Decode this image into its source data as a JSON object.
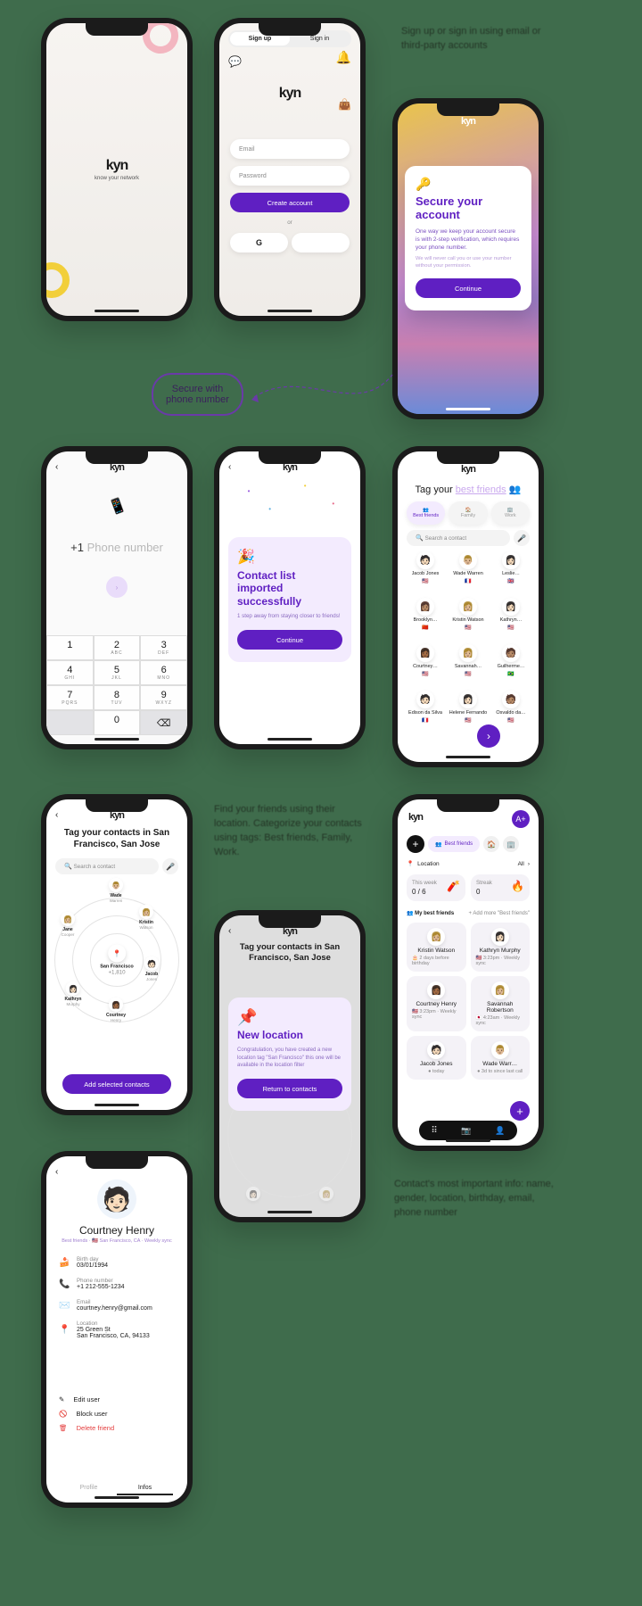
{
  "splash": {
    "brand": "kyn",
    "tagline": "know your network"
  },
  "signup": {
    "tabs": {
      "signup": "Sign up",
      "signin": "Sign in"
    },
    "email_ph": "Email",
    "password_ph": "Password",
    "create_btn": "Create account",
    "or": "or"
  },
  "caption1": "Sign up or sign in using email or third-party accounts",
  "secure": {
    "title": "Secure your account",
    "body": "One way we keep your account secure is with 2-step verification, which requires your phone number.",
    "note": "We will never call you or use your number without your permission.",
    "continue": "Continue"
  },
  "bubble": {
    "line1": "Secure with",
    "line2": "phone number"
  },
  "phone_entry": {
    "prefix": "+1",
    "placeholder": "Phone number",
    "keys": [
      "1",
      "2",
      "3",
      "4",
      "5",
      "6",
      "7",
      "8",
      "9",
      "0"
    ],
    "subs": [
      "",
      "ABC",
      "DEF",
      "GHI",
      "JKL",
      "MNO",
      "PQRS",
      "TUV",
      "WXYZ",
      ""
    ]
  },
  "imported": {
    "title": "Contact list imported successfully",
    "body": "1 step away from staying closer to friends!",
    "continue": "Continue"
  },
  "tag": {
    "title_prefix": "Tag your ",
    "title_highlight": "best friends",
    "search_ph": "Search a contact",
    "tabs": {
      "bf": "Best friends",
      "fam": "Family",
      "work": "Work"
    },
    "contacts": [
      {
        "name": "Jacob Jones",
        "flag": "🇺🇸",
        "emoji": "🧑🏻"
      },
      {
        "name": "Wade Warren",
        "flag": "🇫🇷",
        "emoji": "👨🏼"
      },
      {
        "name": "Leslie…",
        "flag": "🇬🇧",
        "emoji": "👩🏻"
      },
      {
        "name": "Brooklyn…",
        "flag": "🇨🇳",
        "emoji": "👩🏽"
      },
      {
        "name": "Kristin Watson",
        "flag": "🇺🇸",
        "emoji": "👩🏼"
      },
      {
        "name": "Kathryn…",
        "flag": "🇺🇸",
        "emoji": "👩🏻"
      },
      {
        "name": "Courtney…",
        "flag": "🇺🇸",
        "emoji": "👩🏾"
      },
      {
        "name": "Savannah…",
        "flag": "🇺🇸",
        "emoji": "👩🏼"
      },
      {
        "name": "Guilherme…",
        "flag": "🇧🇷",
        "emoji": "🧑🏽"
      },
      {
        "name": "Edison da Silva",
        "flag": "🇫🇷",
        "emoji": "🧑🏻"
      },
      {
        "name": "Helene Fernando",
        "flag": "🇺🇸",
        "emoji": "👩🏻"
      },
      {
        "name": "Osvaldo da…",
        "flag": "🇺🇸",
        "emoji": "🧑🏽"
      }
    ]
  },
  "tag_location": {
    "title": "Tag your contacts in San Francisco, San Jose",
    "search_ph": "Search a contact",
    "center": {
      "label": "San Francisco",
      "count": "+1,810"
    },
    "orbit": [
      {
        "name": "Wade",
        "last": "Warren",
        "emoji": "👨🏼"
      },
      {
        "name": "Kristin",
        "last": "Watson",
        "emoji": "👩🏼"
      },
      {
        "name": "Jacob",
        "last": "Jones",
        "emoji": "🧑🏻"
      },
      {
        "name": "Courtney",
        "last": "Henry",
        "emoji": "👩🏾"
      },
      {
        "name": "Kathryn",
        "last": "Murphy",
        "emoji": "👩🏻"
      },
      {
        "name": "Jane",
        "last": "Cooper",
        "emoji": "👩🏼"
      }
    ],
    "add_btn": "Add selected contacts"
  },
  "caption2": "Find your friends using their location. Categorize your contacts using tags: Best friends, Family, Work.",
  "new_location": {
    "header": "Tag your contacts in San Francisco, San Jose",
    "title": "New location",
    "body": "Congratulation, you have created a new location tag \"San Francisco\" this one will be available in the location filter",
    "btn": "Return to contacts"
  },
  "dashboard": {
    "filter_bf": "Best friends",
    "location_label": "Location",
    "all": "All",
    "week_label": "This week",
    "week_val": "0 / 6",
    "streak_label": "Streak",
    "streak_val": "0",
    "section": "My best friends",
    "add_more": "+ Add more \"Best friends\"",
    "people": [
      {
        "name": "Kristin Watson",
        "meta": "2 days before birthday",
        "emoji": "👩🏼",
        "ico": "🎂"
      },
      {
        "name": "Kathryn Murphy",
        "meta": "3:23pm · Weekly sync",
        "emoji": "👩🏻",
        "flag": "🇺🇸"
      },
      {
        "name": "Courtney Henry",
        "meta": "3:23pm · Weekly sync",
        "emoji": "👩🏾",
        "flag": "🇺🇸"
      },
      {
        "name": "Savannah Robertson",
        "meta": "4:23am · Weekly sync",
        "emoji": "👩🏼",
        "flag": "🇯🇵"
      },
      {
        "name": "Jacob Jones",
        "meta": "today",
        "emoji": "🧑🏻",
        "ico": "●"
      },
      {
        "name": "Wade Warr…",
        "meta": "3d to since last call",
        "emoji": "👨🏼",
        "ico": "●"
      }
    ]
  },
  "caption3": "Contact's most important info: name, gender, location, birthday, email, phone number",
  "profile": {
    "name": "Courtney Henry",
    "tags": "Best friends · 🇺🇸 San Francisco, CA · Weekly sync",
    "fields": [
      {
        "label": "Birth day",
        "value": "03/01/1994",
        "ico": "🍰"
      },
      {
        "label": "Phone number",
        "value": "+1 212-555-1234",
        "ico": "📞"
      },
      {
        "label": "Email",
        "value": "courtney.henry@gmail.com",
        "ico": "✉️"
      },
      {
        "label": "Location",
        "value": "25 Green St\nSan Francisco, CA, 94133",
        "ico": "📍"
      }
    ],
    "edit": "Edit user",
    "block": "Block user",
    "delete": "Delete friend",
    "tab_profile": "Profile",
    "tab_infos": "Infos"
  }
}
